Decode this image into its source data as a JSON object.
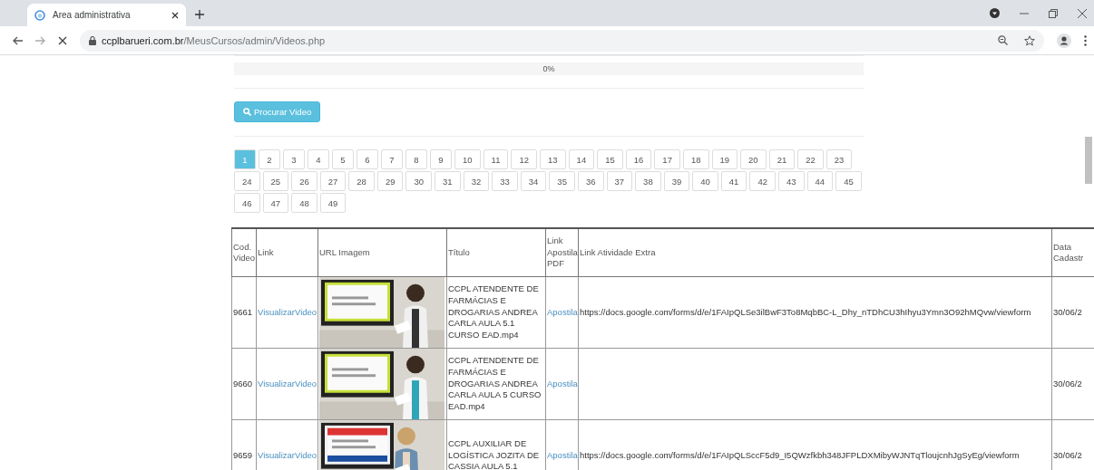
{
  "browser": {
    "tab": {
      "title": "Area administrativa",
      "selected": true
    },
    "address": {
      "host": "ccplbarueri.com.br",
      "path": "/MeusCursos/admin/Videos.php"
    }
  },
  "upload": {
    "level": 0,
    "reading": "0%"
  },
  "search_button": "Procurar Video",
  "pagination": [
    {
      "label": "1",
      "selected": true
    },
    {
      "label": "2",
      "selected": false
    },
    {
      "label": "3",
      "selected": false
    },
    {
      "label": "4",
      "selected": false
    },
    {
      "label": "5",
      "selected": false
    },
    {
      "label": "6",
      "selected": false
    },
    {
      "label": "7",
      "selected": false
    },
    {
      "label": "8",
      "selected": false
    },
    {
      "label": "9",
      "selected": false
    },
    {
      "label": "10",
      "selected": false
    },
    {
      "label": "11",
      "selected": false
    },
    {
      "label": "12",
      "selected": false
    },
    {
      "label": "13",
      "selected": false
    },
    {
      "label": "14",
      "selected": false
    },
    {
      "label": "15",
      "selected": false
    },
    {
      "label": "16",
      "selected": false
    },
    {
      "label": "17",
      "selected": false
    },
    {
      "label": "18",
      "selected": false
    },
    {
      "label": "19",
      "selected": false
    },
    {
      "label": "20",
      "selected": false
    },
    {
      "label": "21",
      "selected": false
    },
    {
      "label": "22",
      "selected": false
    },
    {
      "label": "23",
      "selected": false
    },
    {
      "label": "24",
      "selected": false
    },
    {
      "label": "25",
      "selected": false
    },
    {
      "label": "26",
      "selected": false
    },
    {
      "label": "27",
      "selected": false
    },
    {
      "label": "28",
      "selected": false
    },
    {
      "label": "29",
      "selected": false
    },
    {
      "label": "30",
      "selected": false
    },
    {
      "label": "31",
      "selected": false
    },
    {
      "label": "32",
      "selected": false
    },
    {
      "label": "33",
      "selected": false
    },
    {
      "label": "34",
      "selected": false
    },
    {
      "label": "35",
      "selected": false
    },
    {
      "label": "36",
      "selected": false
    },
    {
      "label": "37",
      "selected": false
    },
    {
      "label": "38",
      "selected": false
    },
    {
      "label": "39",
      "selected": false
    },
    {
      "label": "40",
      "selected": false
    },
    {
      "label": "41",
      "selected": false
    },
    {
      "label": "42",
      "selected": false
    },
    {
      "label": "43",
      "selected": false
    },
    {
      "label": "44",
      "selected": false
    },
    {
      "label": "45",
      "selected": false
    },
    {
      "label": "46",
      "selected": false
    },
    {
      "label": "47",
      "selected": false
    },
    {
      "label": "48",
      "selected": false
    },
    {
      "label": "49",
      "selected": false
    }
  ],
  "table": {
    "columns": [
      "Cod. Video",
      "Link",
      "URL Imagem",
      "Título",
      "Link Apostila PDF",
      "Link Atividade Extra",
      "Data Cadastr"
    ],
    "rows": [
      {
        "code": "9661",
        "link": "VisualizarVideo",
        "title": "CCPL ATENDENTE DE FARMÁCIAS E DROGARIAS ANDREA CARLA AULA 5.1 CURSO EAD.mp4",
        "handout": "Apostila",
        "extra": "https://docs.google.com/forms/d/e/1FAIpQLSe3ilBwF3To8MqbBC-L_Dhy_nTDhCU3hIhyu3Ymn3O92hMQvw/viewform",
        "date": "30/06/2"
      },
      {
        "code": "9660",
        "link": "VisualizarVideo",
        "title": "CCPL ATENDENTE DE FARMÁCIAS E DROGARIAS ANDREA CARLA AULA 5 CURSO EAD.mp4",
        "handout": "Apostila",
        "date": "30/06/2"
      },
      {
        "code": "9659",
        "link": "VisualizarVideo",
        "title": "CCPL AUXILIAR DE LOGÍSTICA JOZITA DE CASSIA AULA 5.1",
        "handout": "Apostila",
        "extra": "https://docs.google.com/forms/d/e/1FAIpQLSccF5d9_I5QWzfkbh348JFPLDXMibyWJNTqTloujcnhJgSyEg/viewform",
        "date": "30/06/2"
      }
    ]
  }
}
